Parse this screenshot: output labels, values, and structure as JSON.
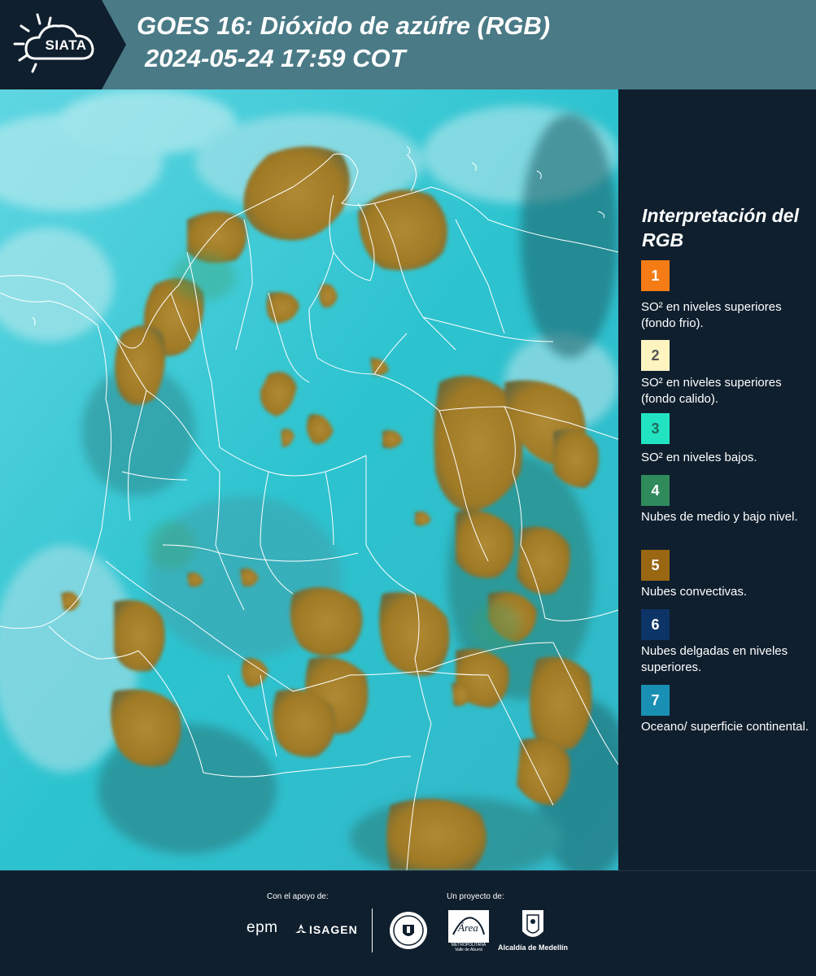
{
  "header": {
    "logo_text": "SIATA",
    "title_line1": "GOES 16: Dióxido de azúfre (RGB)",
    "title_line2": "2024-05-24 17:59 COT",
    "background_color": "#4a7a86"
  },
  "map": {
    "ocean_color": "#2ec8d4",
    "convective_color": "#a8832c",
    "border_color": "#ffffff"
  },
  "legend": {
    "title": "Interpretación del RGB",
    "items": [
      {
        "number": "1",
        "label": "SO² en niveles superiores (fondo frio).",
        "color": "#f57b14",
        "text_color": "#ffffff"
      },
      {
        "number": "2",
        "label": "SO² en niveles superiores (fondo calido).",
        "color": "#fdf4c0",
        "text_color": "#555555"
      },
      {
        "number": "3",
        "label": "SO² en niveles bajos.",
        "color": "#22e3c1",
        "text_color": "#1d6b5e"
      },
      {
        "number": "4",
        "label": "Nubes de medio y bajo nivel.",
        "color": "#2f8a5c",
        "text_color": "#ffffff"
      },
      {
        "number": "5",
        "label": "Nubes convectivas.",
        "color": "#996612",
        "text_color": "#ffffff"
      },
      {
        "number": "6",
        "label": "Nubes delgadas en niveles superiores.",
        "color": "#0c3467",
        "text_color": "#ffffff"
      },
      {
        "number": "7",
        "label": "Oceano/ superficie continental.",
        "color": "#1a8fb4",
        "text_color": "#ffffff"
      }
    ]
  },
  "footer": {
    "support_label": "Con el apoyo de:",
    "project_label": "Un proyecto de:",
    "sponsor1": "epm",
    "sponsor2": "ISAGEN",
    "area_text": "METROPOLITANA Valle de Aburrá",
    "area_logo_text": "Área",
    "alcaldia": "Alcaldía de Medellín"
  }
}
